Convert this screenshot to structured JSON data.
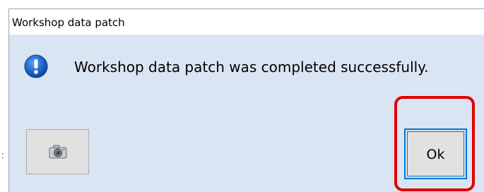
{
  "window": {
    "title": "Workshop data patch"
  },
  "dialog": {
    "icon": "info-icon",
    "message": "Workshop data patch was completed successfully."
  },
  "buttons": {
    "camera_icon": "camera-icon",
    "ok_label": "Ok"
  },
  "colors": {
    "dialog_background": "#dae5f3",
    "button_background": "#e1e1e1",
    "focus_border": "#0078d7",
    "info_icon": "#1d62c9",
    "highlight": "#e00000"
  }
}
